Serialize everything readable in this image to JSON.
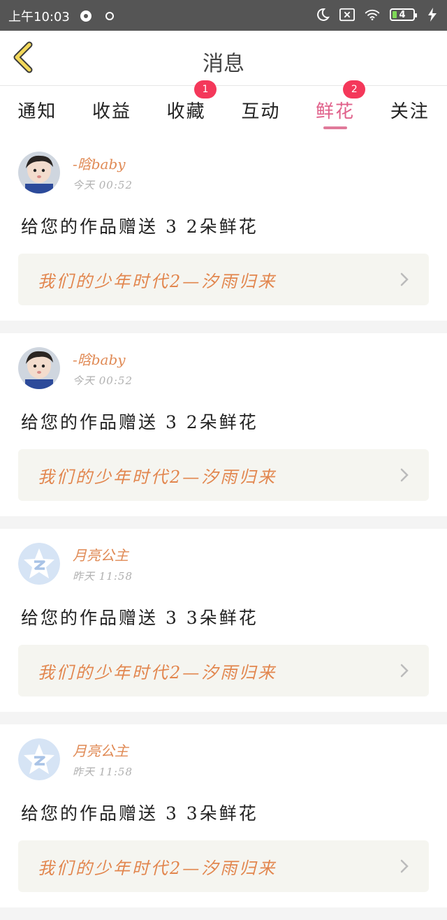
{
  "status": {
    "time": "上午10:03",
    "battery": "4"
  },
  "nav": {
    "title": "消息"
  },
  "tabs": [
    {
      "label": "通知",
      "badge": ""
    },
    {
      "label": "收益",
      "badge": ""
    },
    {
      "label": "收藏",
      "badge": "1"
    },
    {
      "label": "互动",
      "badge": ""
    },
    {
      "label": "鲜花",
      "badge": "2"
    },
    {
      "label": "关注",
      "badge": ""
    }
  ],
  "colors": {
    "accent": "#e0608a",
    "badge": "#f4385a",
    "username": "#e08a55",
    "work_title": "#e2864e"
  },
  "messages": [
    {
      "user": "-晗baby",
      "time": "今天 00:52",
      "text": "给您的作品赠送 3 2朵鲜花",
      "work": "我们的少年时代2—汐雨归来",
      "avatar": "photo"
    },
    {
      "user": "-晗baby",
      "time": "今天 00:52",
      "text": "给您的作品赠送 3 2朵鲜花",
      "work": "我们的少年时代2—汐雨归来",
      "avatar": "photo"
    },
    {
      "user": "月亮公主",
      "time": "昨天 11:58",
      "text": "给您的作品赠送 3 3朵鲜花",
      "work": "我们的少年时代2—汐雨归来",
      "avatar": "default-star-icon"
    },
    {
      "user": "月亮公主",
      "time": "昨天 11:58",
      "text": "给您的作品赠送 3 3朵鲜花",
      "work": "我们的少年时代2—汐雨归来",
      "avatar": "default-star-icon"
    }
  ]
}
